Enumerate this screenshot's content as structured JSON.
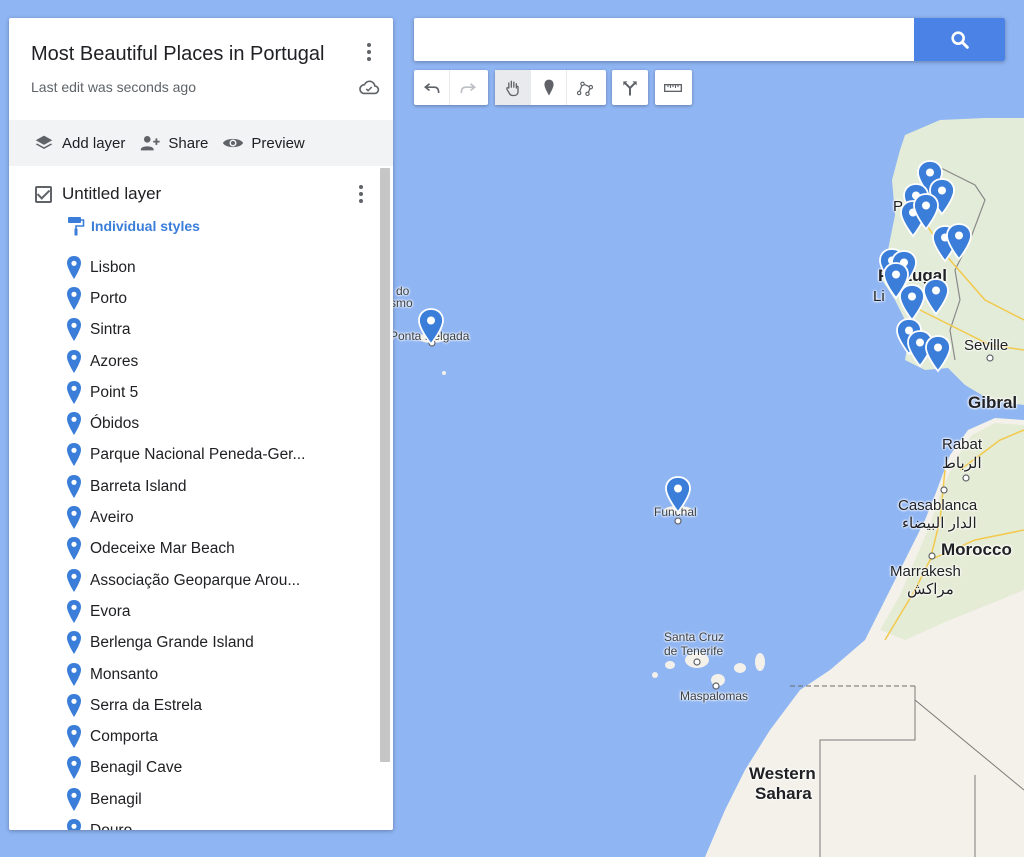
{
  "map_info": {
    "title": "Most Beautiful Places in Portugal",
    "last_edit": "Last edit was seconds ago"
  },
  "actions": {
    "add_layer": "Add layer",
    "share": "Share",
    "preview": "Preview"
  },
  "layer": {
    "name": "Untitled layer",
    "styles_label": "Individual styles",
    "places": [
      "Lisbon",
      "Porto",
      "Sintra",
      "Azores",
      "Point 5",
      "Óbidos",
      "Parque Nacional Peneda-Ger...",
      "Barreta Island",
      "Aveiro",
      "Odeceixe Mar Beach",
      "Associação Geoparque Arou...",
      "Evora",
      "Berlenga Grande Island",
      "Monsanto",
      "Serra da Estrela",
      "Comporta",
      "Benagil Cave",
      "Benagil",
      "Douro"
    ]
  },
  "search": {
    "value": "",
    "placeholder": ""
  },
  "toolbar": {
    "tools": [
      "undo",
      "redo",
      "select-hand",
      "add-marker",
      "draw-line",
      "directions",
      "measure"
    ]
  },
  "map_labels": {
    "portugal": "Portugal",
    "porto": "P",
    "lisbon": "Li",
    "seville": "Seville",
    "gibraltar": "Gibral",
    "rabat": "Rabat",
    "rabat_ar": "الرباط",
    "casablanca": "Casablanca",
    "casablanca_ar": "الدار البيضاء",
    "morocco": "Morocco",
    "marrakesh": "Marrakesh",
    "marrakesh_ar": "مراكش",
    "ponta_delgada": "Ponta Delgada",
    "azores_do": "do",
    "azores_smo": "smo",
    "funchal": "Funchal",
    "santa_cruz": "Santa Cruz",
    "de_tenerife": "de Tenerife",
    "maspalomas": "Maspalomas",
    "western": "Western",
    "sahara": "Sahara"
  },
  "colors": {
    "ocean": "#8fb5f3",
    "land": "#f4f1ea",
    "marker": "#3b7ed9",
    "accent": "#4b82e6"
  }
}
